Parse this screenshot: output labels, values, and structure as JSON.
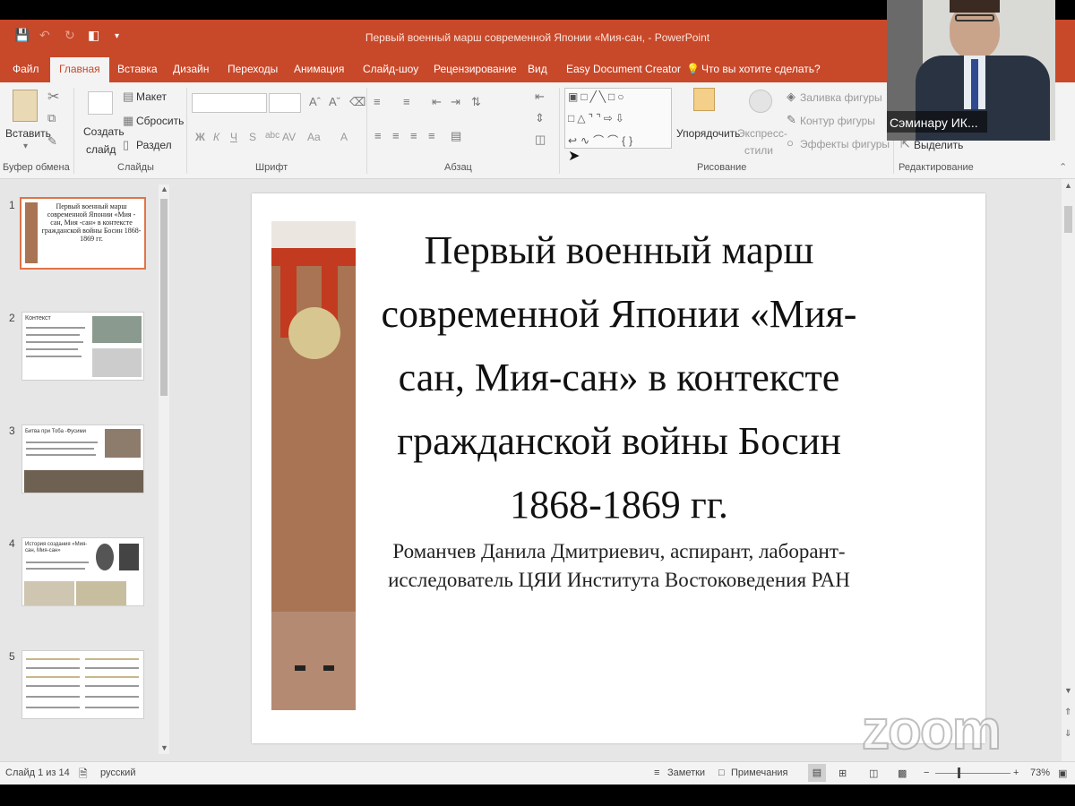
{
  "app": {
    "window_title": "Первый военный марш современной Японии «Мия-сан, - PowerPoint"
  },
  "tabs": [
    {
      "label": "Файл"
    },
    {
      "label": "Главная"
    },
    {
      "label": "Вставка"
    },
    {
      "label": "Дизайн"
    },
    {
      "label": "Переходы"
    },
    {
      "label": "Анимация"
    },
    {
      "label": "Слайд-шоу"
    },
    {
      "label": "Рецензирование"
    },
    {
      "label": "Вид"
    },
    {
      "label": "Easy Document Creator"
    },
    {
      "label": "Что вы хотите сделать?"
    }
  ],
  "ribbon": {
    "clipboard": {
      "paste": "Вставить",
      "group": "Буфер обмена"
    },
    "slides": {
      "create": "Создать",
      "create2": "слайд",
      "layout": "Макет",
      "reset": "Сбросить",
      "section": "Раздел",
      "group": "Слайды"
    },
    "font": {
      "group": "Шрифт",
      "bold": "Ж",
      "italic": "К",
      "underline": "Ч",
      "strike": "S",
      "spacing": "AV",
      "case": "Aa"
    },
    "paragraph": {
      "group": "Абзац"
    },
    "drawing": {
      "arrange": "Упорядочить",
      "quick_styles": "Экспресс-",
      "quick_styles2": "стили",
      "fill": "Заливка фигуры",
      "outline": "Контур фигуры",
      "effects": "Эффекты фигуры",
      "group": "Рисование"
    },
    "editing": {
      "select": "Выделить",
      "group": "Редактирование"
    }
  },
  "thumbnails": [
    {
      "num": "1",
      "text": "Первый военный марш современной Японии «Мия - сан, Мия -сан» в контексте гражданской войны Босин 1868-1869 гг."
    },
    {
      "num": "2",
      "text": "Контекст"
    },
    {
      "num": "3",
      "text": "Битва при Тоба -Фусими"
    },
    {
      "num": "4",
      "text": "История создания «Мия-сан, Мия-сан»"
    },
    {
      "num": "5",
      "text": ""
    }
  ],
  "slide": {
    "title": "Первый военный марш современной Японии «Мия-сан, Мия-сан» в контексте гражданской войны Босин 1868-1869 гг.",
    "subtitle": "Романчев Данила Дмитриевич, аспирант, лаборант-исследователь ЦЯИ Института Востоковедения РАН"
  },
  "video": {
    "participant_name": "Сэминару ИК..."
  },
  "watermark": "zoom",
  "status": {
    "slide_counter": "Слайд 1 из 14",
    "language": "русский",
    "notes": "Заметки",
    "comments": "Примечания",
    "zoom": "73%"
  },
  "colors": {
    "accent": "#c8482a",
    "thumb_selected": "#e27346"
  }
}
